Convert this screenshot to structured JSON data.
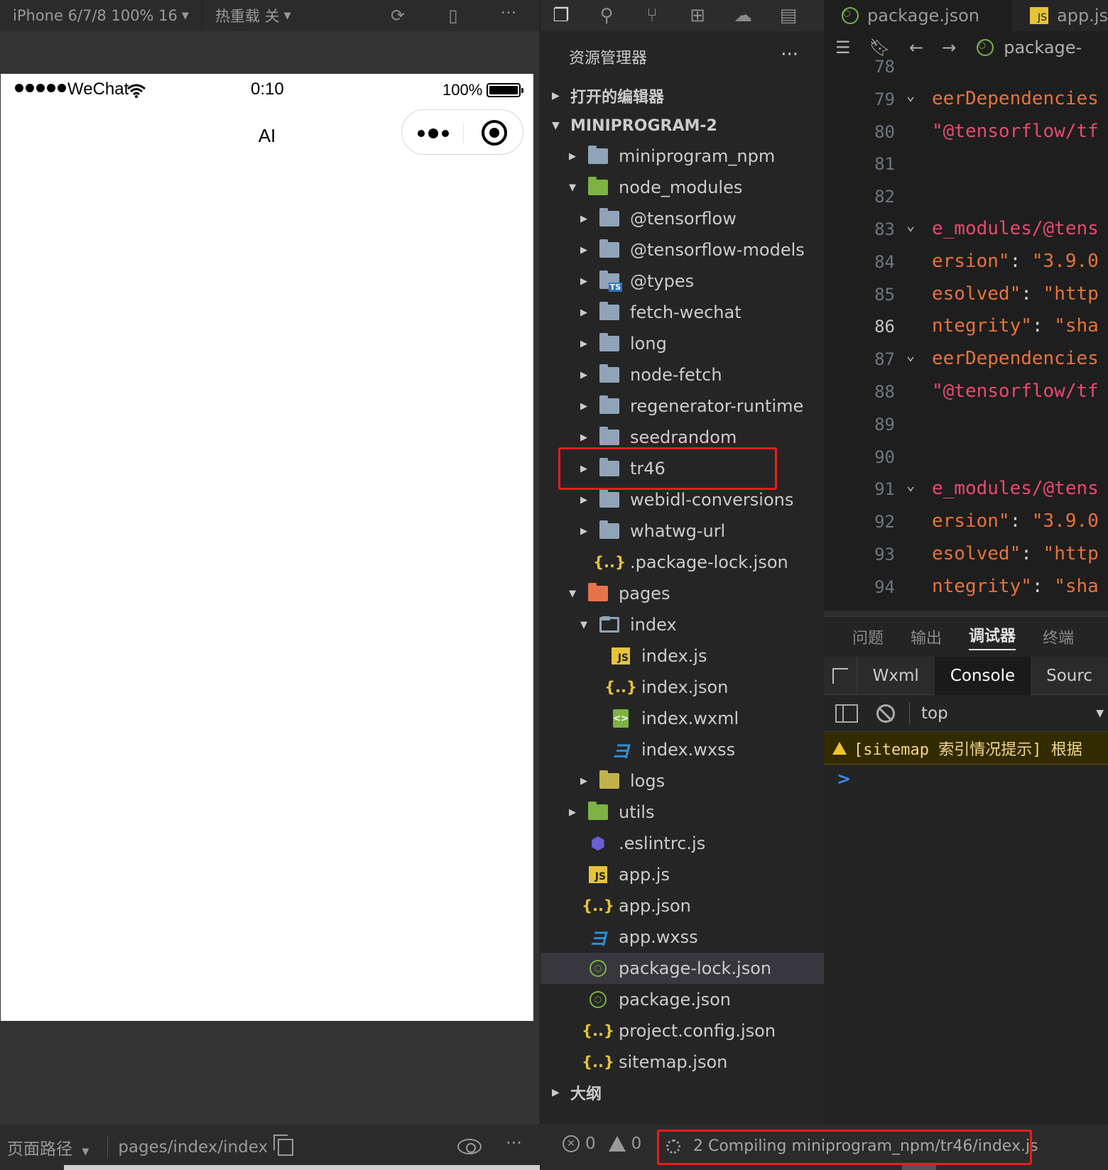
{
  "simulator": {
    "device_label": "iPhone 6/7/8 100% 16",
    "hot_reload_label": "热重载 关",
    "status": {
      "carrier": "WeChat",
      "time": "0:10",
      "battery": "100%"
    },
    "nav_title": "AI",
    "bottom": {
      "path_label": "页面路径",
      "path_value": "pages/index/index",
      "more": "···"
    },
    "toolbar_more": "···"
  },
  "explorer": {
    "title": "资源管理器",
    "more": "···",
    "open_editors": "打开的编辑器",
    "project": "MINIPROGRAM-2",
    "outline": "大纲",
    "tree": [
      {
        "label": "miniprogram_npm",
        "icon": "folder",
        "depth": 0,
        "expand": "closed"
      },
      {
        "label": "node_modules",
        "icon": "folder-green",
        "depth": 0,
        "expand": "open"
      },
      {
        "label": "@tensorflow",
        "icon": "folder",
        "depth": 1,
        "expand": "closed"
      },
      {
        "label": "@tensorflow-models",
        "icon": "folder",
        "depth": 1,
        "expand": "closed"
      },
      {
        "label": "@types",
        "icon": "folder-ts",
        "depth": 1,
        "expand": "closed"
      },
      {
        "label": "fetch-wechat",
        "icon": "folder",
        "depth": 1,
        "expand": "closed"
      },
      {
        "label": "long",
        "icon": "folder",
        "depth": 1,
        "expand": "closed"
      },
      {
        "label": "node-fetch",
        "icon": "folder",
        "depth": 1,
        "expand": "closed"
      },
      {
        "label": "regenerator-runtime",
        "icon": "folder",
        "depth": 1,
        "expand": "closed"
      },
      {
        "label": "seedrandom",
        "icon": "folder",
        "depth": 1,
        "expand": "closed"
      },
      {
        "label": "tr46",
        "icon": "folder",
        "depth": 1,
        "expand": "closed"
      },
      {
        "label": "webidl-conversions",
        "icon": "folder",
        "depth": 1,
        "expand": "closed"
      },
      {
        "label": "whatwg-url",
        "icon": "folder",
        "depth": 1,
        "expand": "closed"
      },
      {
        "label": ".package-lock.json",
        "icon": "json",
        "depth": 1,
        "expand": "none"
      },
      {
        "label": "pages",
        "icon": "folder-orange",
        "depth": 0,
        "expand": "open"
      },
      {
        "label": "index",
        "icon": "folder-open",
        "depth": 1,
        "expand": "open"
      },
      {
        "label": "index.js",
        "icon": "js",
        "depth": 2,
        "expand": "none"
      },
      {
        "label": "index.json",
        "icon": "json",
        "depth": 2,
        "expand": "none"
      },
      {
        "label": "index.wxml",
        "icon": "wxml",
        "depth": 2,
        "expand": "none"
      },
      {
        "label": "index.wxss",
        "icon": "css",
        "depth": 2,
        "expand": "none"
      },
      {
        "label": "logs",
        "icon": "folder-yellow",
        "depth": 1,
        "expand": "closed"
      },
      {
        "label": "utils",
        "icon": "folder-green",
        "depth": 0,
        "expand": "closed"
      },
      {
        "label": ".eslintrc.js",
        "icon": "eslint",
        "depth": 0,
        "expand": "none"
      },
      {
        "label": "app.js",
        "icon": "js",
        "depth": 0,
        "expand": "none"
      },
      {
        "label": "app.json",
        "icon": "json",
        "depth": 0,
        "expand": "none"
      },
      {
        "label": "app.wxss",
        "icon": "css",
        "depth": 0,
        "expand": "none"
      },
      {
        "label": "package-lock.json",
        "icon": "npm",
        "depth": 0,
        "expand": "none",
        "selected": true
      },
      {
        "label": "package.json",
        "icon": "npm",
        "depth": 0,
        "expand": "none"
      },
      {
        "label": "project.config.json",
        "icon": "json",
        "depth": 0,
        "expand": "none"
      },
      {
        "label": "sitemap.json",
        "icon": "json",
        "depth": 0,
        "expand": "none"
      }
    ]
  },
  "editor": {
    "tabs": [
      {
        "label": "package.json",
        "icon": "npm"
      },
      {
        "label": "app.js",
        "icon": "js"
      }
    ],
    "breadcrumb_file": "package-",
    "lines": [
      {
        "n": "78",
        "fold": false,
        "parts": []
      },
      {
        "n": "79",
        "fold": true,
        "parts": [
          {
            "c": "k",
            "t": "eerDependencies"
          }
        ]
      },
      {
        "n": "80",
        "fold": false,
        "parts": [
          {
            "c": "tf",
            "t": "\"@tensorflow/tf"
          }
        ]
      },
      {
        "n": "81",
        "fold": false,
        "parts": []
      },
      {
        "n": "82",
        "fold": false,
        "parts": []
      },
      {
        "n": "83",
        "fold": true,
        "parts": [
          {
            "c": "tf",
            "t": "e_modules/@tens"
          }
        ]
      },
      {
        "n": "84",
        "fold": false,
        "parts": [
          {
            "c": "k",
            "t": "ersion\""
          },
          {
            "c": "p",
            "t": ": "
          },
          {
            "c": "sv",
            "t": "\"3.9.0"
          }
        ]
      },
      {
        "n": "85",
        "fold": false,
        "parts": [
          {
            "c": "k",
            "t": "esolved\""
          },
          {
            "c": "p",
            "t": ": "
          },
          {
            "c": "sv",
            "t": "\"http"
          }
        ]
      },
      {
        "n": "86",
        "fold": false,
        "current": true,
        "parts": [
          {
            "c": "k",
            "t": "ntegrity\""
          },
          {
            "c": "p",
            "t": ": "
          },
          {
            "c": "sv",
            "t": "\"sha"
          }
        ]
      },
      {
        "n": "87",
        "fold": true,
        "parts": [
          {
            "c": "k",
            "t": "eerDependencies"
          }
        ]
      },
      {
        "n": "88",
        "fold": false,
        "parts": [
          {
            "c": "tf",
            "t": "\"@tensorflow/tf"
          }
        ]
      },
      {
        "n": "89",
        "fold": false,
        "parts": []
      },
      {
        "n": "90",
        "fold": false,
        "parts": []
      },
      {
        "n": "91",
        "fold": true,
        "parts": [
          {
            "c": "tf",
            "t": "e_modules/@tens"
          }
        ]
      },
      {
        "n": "92",
        "fold": false,
        "parts": [
          {
            "c": "k",
            "t": "ersion\""
          },
          {
            "c": "p",
            "t": ": "
          },
          {
            "c": "sv",
            "t": "\"3.9.0"
          }
        ]
      },
      {
        "n": "93",
        "fold": false,
        "parts": [
          {
            "c": "k",
            "t": "esolved\""
          },
          {
            "c": "p",
            "t": ": "
          },
          {
            "c": "sv",
            "t": "\"http"
          }
        ]
      },
      {
        "n": "94",
        "fold": false,
        "parts": [
          {
            "c": "k",
            "t": "ntegrity\""
          },
          {
            "c": "p",
            "t": ": "
          },
          {
            "c": "sv",
            "t": "\"sha"
          }
        ]
      }
    ]
  },
  "panel": {
    "tabs": [
      "问题",
      "输出",
      "调试器",
      "终端"
    ],
    "active_tab": "调试器",
    "devtools_tabs": [
      "Wxml",
      "Console",
      "Sourc"
    ],
    "active_devtools_tab": "Console",
    "context": "top",
    "warning": "[sitemap 索引情况提示] 根据",
    "prompt": ">"
  },
  "statusbar": {
    "errors": "0",
    "warnings": "0",
    "compile_message": "2 Compiling miniprogram_npm/tr46/index.js"
  },
  "colors": {
    "highlight_box": "#ee1b1b",
    "accent_blue": "#3d8bf0"
  }
}
